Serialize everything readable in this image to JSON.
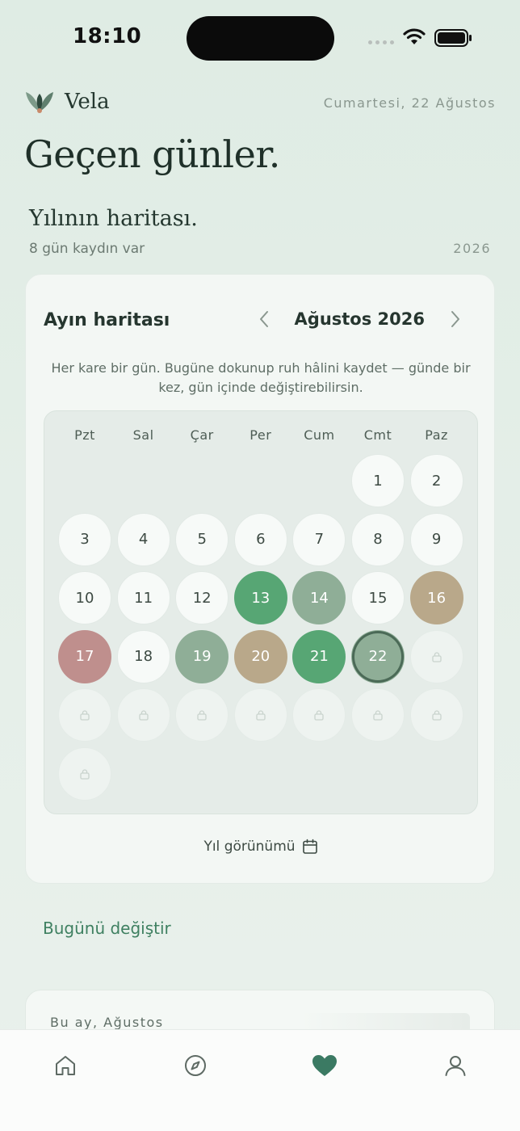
{
  "status_bar": {
    "time": "18:10"
  },
  "header": {
    "app_name": "Vela",
    "date": "Cumartesi, 22 Ağustos",
    "page_title": "Geçen günler."
  },
  "year_section": {
    "title": "Yılının haritası.",
    "subtitle": "8 gün kaydın var",
    "year": "2026"
  },
  "month_card": {
    "title": "Ayın haritası",
    "month_label": "Ağustos 2026",
    "hint": "Her kare bir gün. Bugüne dokunup ruh hâlini kaydet — günde bir kez, gün içinde değiştirebilirsin.",
    "weekdays": [
      "Pzt",
      "Sal",
      "Çar",
      "Per",
      "Cum",
      "Cmt",
      "Paz"
    ],
    "days": [
      {
        "label": "1",
        "state": "empty"
      },
      {
        "label": "2",
        "state": "empty"
      },
      {
        "label": "3",
        "state": "empty"
      },
      {
        "label": "4",
        "state": "empty"
      },
      {
        "label": "5",
        "state": "empty"
      },
      {
        "label": "6",
        "state": "empty"
      },
      {
        "label": "7",
        "state": "empty"
      },
      {
        "label": "8",
        "state": "empty"
      },
      {
        "label": "9",
        "state": "empty"
      },
      {
        "label": "10",
        "state": "empty"
      },
      {
        "label": "11",
        "state": "empty"
      },
      {
        "label": "12",
        "state": "empty"
      },
      {
        "label": "13",
        "state": "mood",
        "color": "#57a674"
      },
      {
        "label": "14",
        "state": "mood",
        "color": "#8fae97"
      },
      {
        "label": "15",
        "state": "empty"
      },
      {
        "label": "16",
        "state": "mood",
        "color": "#b9a88a"
      },
      {
        "label": "17",
        "state": "mood",
        "color": "#bf8f8d"
      },
      {
        "label": "18",
        "state": "empty"
      },
      {
        "label": "19",
        "state": "mood",
        "color": "#8fae97"
      },
      {
        "label": "20",
        "state": "mood",
        "color": "#b9a88a"
      },
      {
        "label": "21",
        "state": "mood",
        "color": "#57a674"
      },
      {
        "label": "22",
        "state": "today",
        "color": "#8fae97"
      },
      {
        "label": "",
        "state": "locked"
      },
      {
        "label": "",
        "state": "locked"
      },
      {
        "label": "",
        "state": "locked"
      },
      {
        "label": "",
        "state": "locked"
      },
      {
        "label": "",
        "state": "locked"
      },
      {
        "label": "",
        "state": "locked"
      },
      {
        "label": "",
        "state": "locked"
      },
      {
        "label": "",
        "state": "locked"
      },
      {
        "label": "",
        "state": "locked"
      }
    ],
    "year_view_label": "Yıl görünümü"
  },
  "change_today_label": "Bugünü değiştir",
  "summary_card": {
    "label": "Bu ay, Ağustos"
  },
  "tabbar": {
    "items": [
      {
        "icon": "home-icon"
      },
      {
        "icon": "compass-icon"
      },
      {
        "icon": "heart-icon",
        "active": true
      },
      {
        "icon": "profile-icon"
      }
    ]
  },
  "colors": {
    "accent": "#3f8061",
    "active_tab": "#3b7a63",
    "mood_green": "#57a674",
    "mood_sage": "#8fae97",
    "mood_tan": "#b9a88a",
    "mood_rose": "#bf8f8d"
  }
}
